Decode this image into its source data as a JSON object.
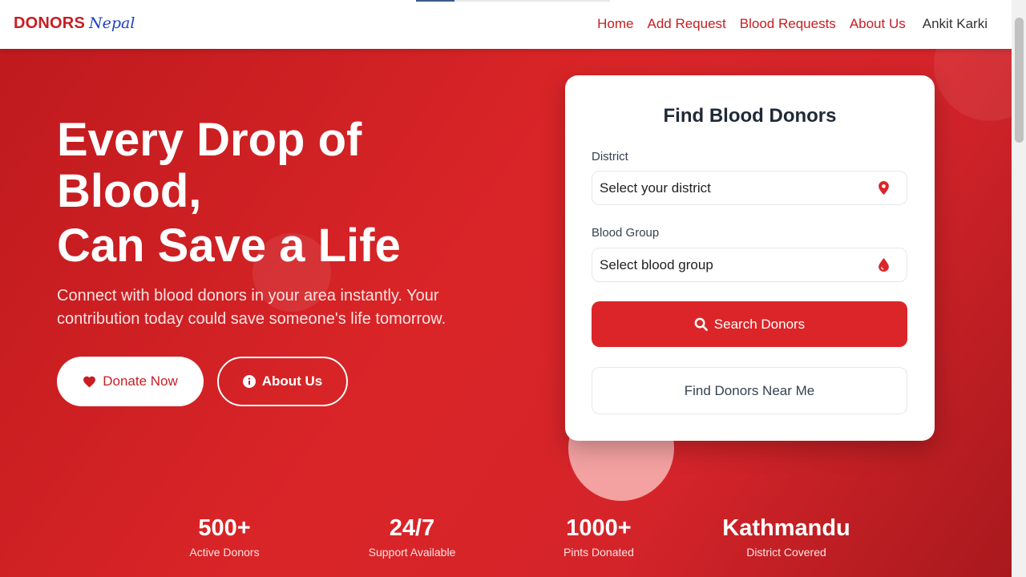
{
  "brand": {
    "name": "DONORS",
    "script": "Nepal"
  },
  "nav": {
    "links": [
      "Home",
      "Add Request",
      "Blood Requests",
      "About Us"
    ],
    "user": "Ankit Karki"
  },
  "page_progress": 0.2,
  "hero": {
    "headline_line1": "Every Drop of",
    "headline_line2": "Blood,",
    "headline_line3": "Can Save a Life",
    "subtext": "Connect with blood donors in your area instantly. Your contribution today could save someone's life tomorrow.",
    "donate_label": "Donate Now",
    "about_label": "About Us"
  },
  "search_card": {
    "title": "Find Blood Donors",
    "district_label": "District",
    "district_placeholder": "Select your district",
    "blood_group_label": "Blood Group",
    "blood_group_placeholder": "Select blood group",
    "search_label": "Search Donors",
    "near_me_label": "Find Donors Near Me"
  },
  "stats": [
    {
      "value": "500+",
      "label": "Active Donors"
    },
    {
      "value": "24/7",
      "label": "Support Available"
    },
    {
      "value": "1000+",
      "label": "Pints Donated"
    },
    {
      "value": "Kathmandu",
      "label": "District Covered"
    }
  ],
  "colors": {
    "primary": "#c81d21",
    "button": "#dc2528",
    "accent_blue": "#1f3fc7"
  },
  "icons": {
    "donate": "heart-icon",
    "about": "info-icon",
    "district": "map-pin-icon",
    "blood_group": "blood-drop-icon",
    "search": "search-icon"
  }
}
